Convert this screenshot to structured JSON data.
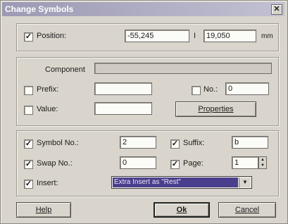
{
  "title": "Change Symbols",
  "position": {
    "label": "Position:",
    "checked": true,
    "x_value": "-55,245",
    "separator": "I",
    "y_value": "19,050",
    "unit": "mm"
  },
  "component": {
    "label": "Component",
    "value": "",
    "prefix": {
      "label": "Prefix:",
      "checked": false,
      "value": ""
    },
    "value_field": {
      "label": "Value:",
      "checked": false,
      "value": ""
    },
    "number": {
      "label": "No.:",
      "checked": false,
      "value": "0"
    },
    "properties_button": "Properties"
  },
  "symbol": {
    "symbol_no": {
      "label": "Symbol No.:",
      "checked": true,
      "value": "2"
    },
    "swap_no": {
      "label": "Swap No.:",
      "checked": true,
      "value": "0"
    },
    "insert": {
      "label": "Insert:",
      "checked": true,
      "value": "Extra Insert as \"Rest\""
    },
    "suffix": {
      "label": "Suffix:",
      "checked": true,
      "value": "b"
    },
    "page": {
      "label": "Page:",
      "checked": true,
      "value": "1"
    }
  },
  "buttons": {
    "help": "Help",
    "ok": "Ok",
    "cancel": "Cancel"
  },
  "icons": {
    "close": "close-icon",
    "dropdown": "chevron-down-icon",
    "spin_up": "spin-up-icon",
    "spin_down": "spin-down-icon"
  }
}
